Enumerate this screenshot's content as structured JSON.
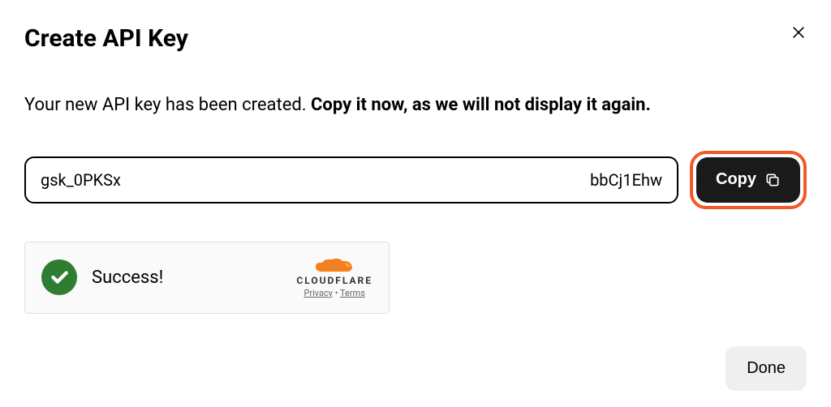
{
  "modal": {
    "title": "Create API Key",
    "description_plain": "Your new API key has been created. ",
    "description_bold": "Copy it now, as we will not display it again.",
    "key_prefix": "gsk_0PKSx",
    "key_suffix": "bbCj1Ehw",
    "copy_label": "Copy",
    "done_label": "Done"
  },
  "captcha": {
    "status": "Success!",
    "brand": "CLOUDFLARE",
    "privacy_label": "Privacy",
    "terms_label": "Terms",
    "separator": " • "
  }
}
